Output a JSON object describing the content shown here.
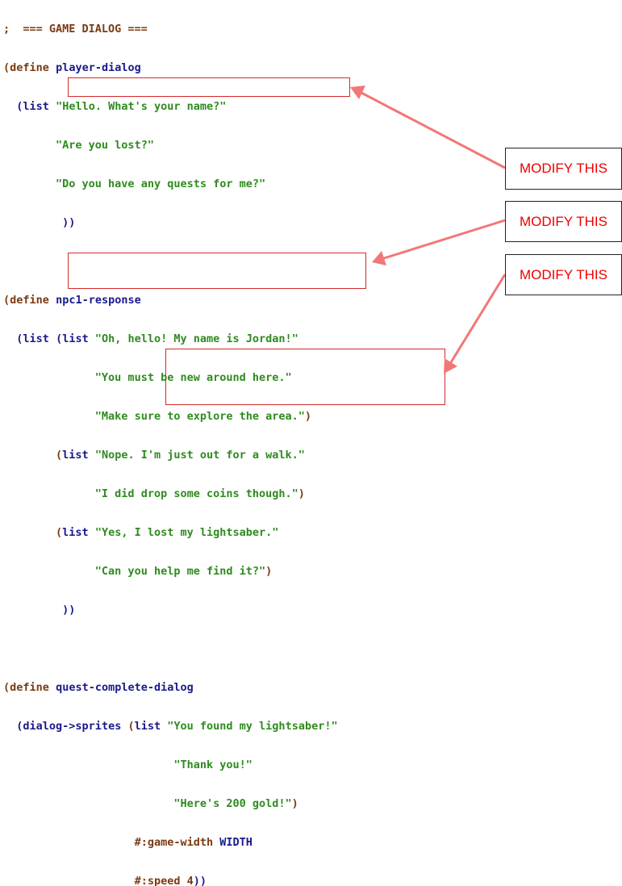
{
  "code": {
    "comment": ";  === GAME DIALOG ===",
    "define_kw": "define",
    "list_kw": "list",
    "player_dialog_name": "player-dialog",
    "player_lines": [
      "\"Hello. What's your name?\"",
      "\"Are you lost?\"",
      "\"Do you have any quests for me?\""
    ],
    "npc_response_name": "npc1-response",
    "npc_group1": [
      "\"Oh, hello! My name is Jordan!\"",
      "\"You must be new around here.\"",
      "\"Make sure to explore the area.\""
    ],
    "npc_group2": [
      "\"Nope. I'm just out for a walk.\"",
      "\"I did drop some coins though.\""
    ],
    "npc_group3": [
      "\"Yes, I lost my lightsaber.\"",
      "\"Can you help me find it?\""
    ],
    "quest_complete_name": "quest-complete-dialog",
    "dialog_fn": "dialog->sprites",
    "quest_lines": [
      "\"You found my lightsaber!\"",
      "\"Thank you!\"",
      "\"Here's 200 gold!\""
    ],
    "kw_game_width": "#:game-width",
    "width_const": "WIDTH",
    "kw_speed": "#:speed",
    "speed_value": "4"
  },
  "callouts": [
    "MODIFY THIS",
    "MODIFY THIS",
    "MODIFY THIS"
  ],
  "colors": {
    "keyword": "#7b3a12",
    "identifier": "#19198c",
    "string": "#2e8b1e",
    "highlight_box": "#d42a2a",
    "arrow": "#f27777",
    "callout_text": "#ee0000"
  }
}
